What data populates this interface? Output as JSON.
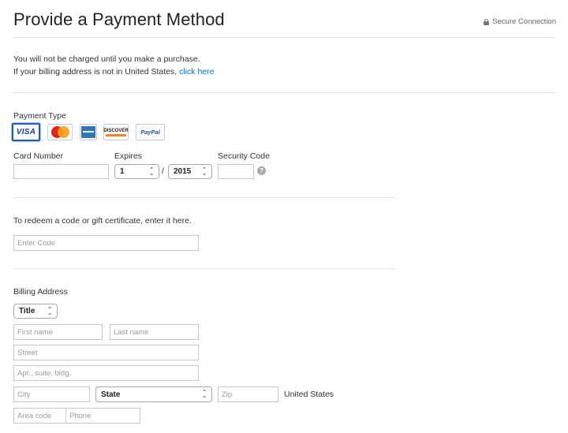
{
  "header": {
    "title": "Provide a Payment Method",
    "secure_label": "Secure Connection"
  },
  "notice": {
    "line1": "You will not be charged until you make a purchase.",
    "line2_prefix": "If your billing address is not in United States, ",
    "line2_link": "click here"
  },
  "payment": {
    "section_label": "Payment Type",
    "cards": [
      {
        "name": "VISA",
        "selected": true
      },
      {
        "name": "MasterCard",
        "selected": false
      },
      {
        "name": "American Express",
        "selected": false
      },
      {
        "name": "DISCOVER",
        "selected": false
      },
      {
        "name": "PayPal",
        "selected": false
      }
    ],
    "card_number_label": "Card Number",
    "card_number_value": "",
    "expires_label": "Expires",
    "expires_month": "1",
    "expires_separator": "/",
    "expires_year": "2015",
    "security_code_label": "Security Code",
    "security_code_value": "",
    "help_glyph": "?"
  },
  "redeem": {
    "prompt": "To redeem a code or gift certificate, enter it here.",
    "code_placeholder": "Enter Code"
  },
  "billing": {
    "section_label": "Billing Address",
    "title_select": "Title",
    "first_name_placeholder": "First name",
    "last_name_placeholder": "Last name",
    "street_placeholder": "Street",
    "apt_placeholder": "Apt., suite, bldg.",
    "city_placeholder": "City",
    "state_select": "State",
    "zip_placeholder": "Zip",
    "country": "United States",
    "area_code_placeholder": "Area code",
    "phone_placeholder": "Phone"
  },
  "colors": {
    "link": "#0070c9",
    "selected_card_border": "#1e5eb6",
    "visa_blue": "#1a3d8f",
    "mastercard_red": "#e2231a",
    "mastercard_orange": "#f79e1b",
    "amex_blue": "#2e77bb",
    "discover_orange": "#f58220"
  },
  "icons": {
    "secure": "lock-icon",
    "chevron": "chevron-updown-icon",
    "help": "question-circle-icon"
  }
}
